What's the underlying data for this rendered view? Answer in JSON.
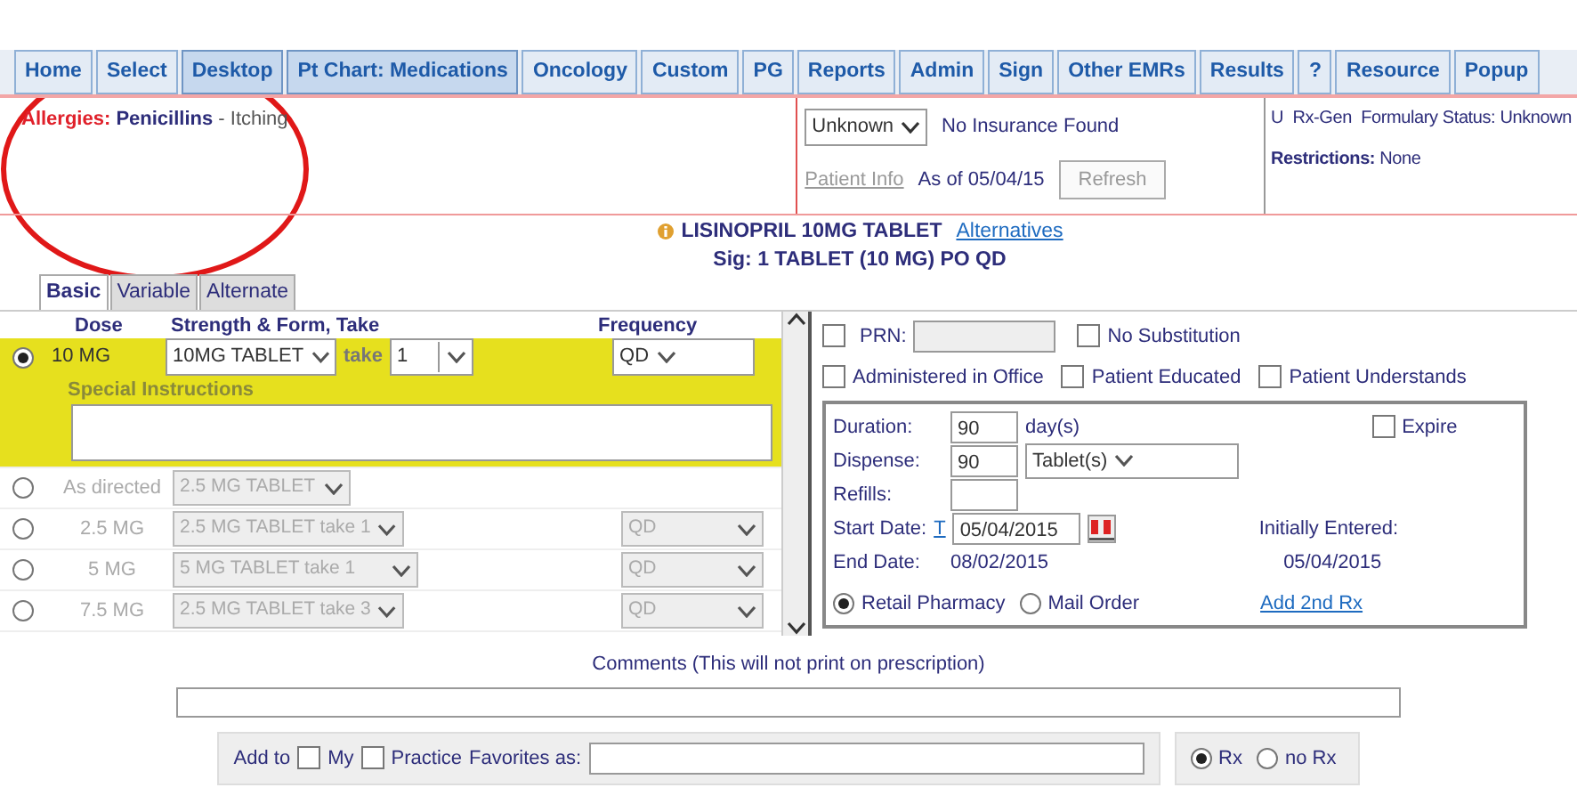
{
  "nav_tabs": [
    {
      "label": "Home",
      "selected": false
    },
    {
      "label": "Select",
      "selected": false
    },
    {
      "label": "Desktop",
      "selected": true
    },
    {
      "label": "Pt Chart: Medications",
      "selected": true
    },
    {
      "label": "Oncology",
      "selected": false
    },
    {
      "label": "Custom",
      "selected": false
    },
    {
      "label": "PG",
      "selected": false
    },
    {
      "label": "Reports",
      "selected": false
    },
    {
      "label": "Admin",
      "selected": false
    },
    {
      "label": "Sign",
      "selected": false
    },
    {
      "label": "Other EMRs",
      "selected": false
    },
    {
      "label": "Results",
      "selected": false
    },
    {
      "label": "?",
      "selected": false
    },
    {
      "label": "Resource",
      "selected": false
    },
    {
      "label": "Popup",
      "selected": false
    }
  ],
  "allergies": {
    "label": "Allergies:",
    "substance": "Penicillins",
    "reaction": "- Itching"
  },
  "insurance": {
    "plan": "Unknown",
    "status": "No Insurance Found",
    "link": "Patient Info",
    "as_of": "As of 05/04/15",
    "button": "Refresh"
  },
  "formulary": {
    "status": "U  Rx-Gen  Formulary Status: Unknown",
    "restrictions_label": "Restrictions:",
    "restrictions": "None"
  },
  "drug": {
    "name": "LISINOPRIL 10MG TABLET",
    "alternatives": "Alternatives",
    "sig": "Sig: 1 TABLET (10 MG) PO QD"
  },
  "sub_tabs": [
    {
      "label": "Basic",
      "selected": true
    },
    {
      "label": "Variable",
      "selected": false
    },
    {
      "label": "Alternate",
      "selected": false
    }
  ],
  "dose_table": {
    "columns": [
      "Dose",
      "Strength & Form, Take",
      "Frequency"
    ],
    "rows": [
      {
        "kind": "active",
        "dose": "10 MG",
        "strength": "10MG TABLET",
        "take_label": "take",
        "take": "1",
        "frequency": "QD",
        "selected": true,
        "special_label": "Special Instructions"
      },
      {
        "kind": "plain",
        "dose": "As directed",
        "strength": "2.5 MG TABLET",
        "selected": false
      },
      {
        "kind": "plain",
        "dose": "2.5 MG",
        "strength": "2.5 MG TABLET take 1",
        "frequency": "QD",
        "selected": false
      },
      {
        "kind": "plain",
        "dose": "5 MG",
        "strength": "5 MG TABLET take 1",
        "frequency": "QD",
        "selected": false
      },
      {
        "kind": "plain",
        "dose": "7.5 MG",
        "strength": "2.5 MG TABLET take 3",
        "frequency": "QD",
        "selected": false
      }
    ]
  },
  "options": {
    "prn": {
      "label": "PRN:",
      "checked": false
    },
    "no_substitution": {
      "label": "No Substitution",
      "checked": false
    },
    "checkboxes": [
      {
        "label": "Administered in Office",
        "checked": false
      },
      {
        "label": "Patient Educated",
        "checked": false
      },
      {
        "label": "Patient Understands",
        "checked": false
      }
    ]
  },
  "dispense": {
    "duration_label": "Duration:",
    "duration": "90",
    "duration_unit": "day(s)",
    "expire": {
      "label": "Expire",
      "checked": false
    },
    "dispense_label": "Dispense:",
    "dispense": "90",
    "unit": "Tablet(s)",
    "refills_label": "Refills:",
    "start_label": "Start Date:",
    "today_link": "T",
    "start_date": "05/04/2015",
    "end_label": "End Date:",
    "end_date": "08/02/2015",
    "initial_label": "Initially Entered:",
    "initial_date": "05/04/2015",
    "delivery": [
      {
        "label": "Retail Pharmacy",
        "selected": true
      },
      {
        "label": "Mail Order",
        "selected": false
      }
    ],
    "add_link": "Add 2nd Rx"
  },
  "comments": {
    "label": "Comments (This will not print on prescription)"
  },
  "favorites": {
    "add_to": "Add to",
    "checkboxes": [
      {
        "label": "My",
        "checked": false
      },
      {
        "label": "Practice",
        "checked": false
      }
    ],
    "as_label": "Favorites as:",
    "rx_options": [
      {
        "label": "Rx",
        "selected": true
      },
      {
        "label": "no Rx",
        "selected": false
      }
    ]
  }
}
